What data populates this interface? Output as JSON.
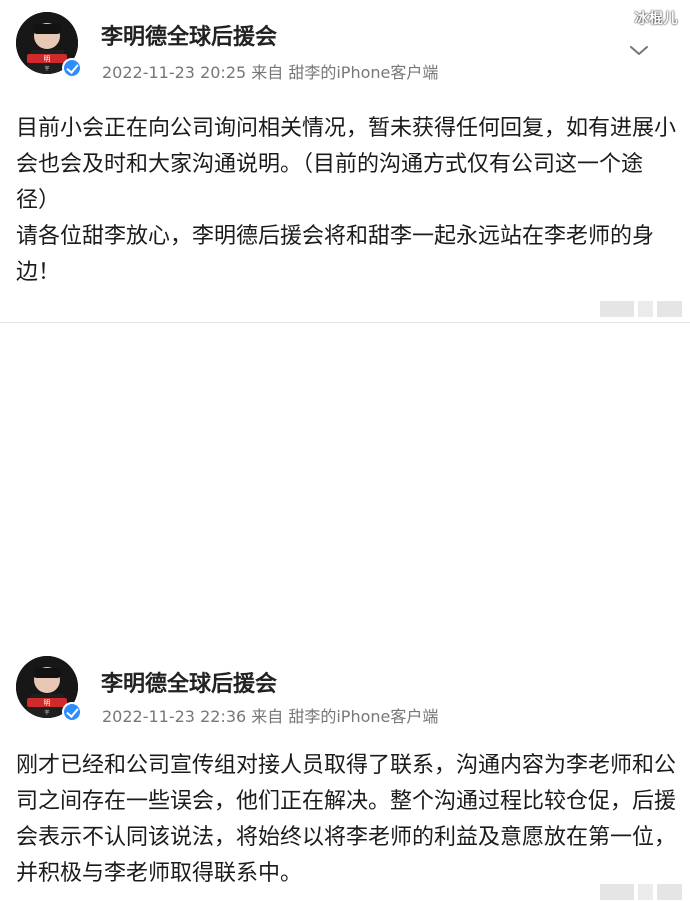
{
  "watermark": {
    "text": "冰棍儿"
  },
  "posts": [
    {
      "author": "李明德全球后援会",
      "meta": "2022-11-23 20:25  来自 甜李的iPhone客户端",
      "content": "目前小会正在向公司询问相关情况，暂未获得任何回复，如有进展小会也会及时和大家沟通说明。（目前的沟通方式仅有公司这一个途径）\n请各位甜李放心，李明德后援会将和甜李一起永远站在李老师的身边！",
      "avatar_text_top": "明",
      "avatar_text_bottom": "宇"
    },
    {
      "author": "李明德全球后援会",
      "meta": "2022-11-23 22:36  来自 甜李的iPhone客户端",
      "content": "刚才已经和公司宣传组对接人员取得了联系，沟通内容为李老师和公司之间存在一些误会，他们正在解决。整个沟通过程比较仓促，后援会表示不认同该说法，将始终以将李老师的利益及意愿放在第一位，并积极与李老师取得联系中。",
      "avatar_text_top": "明",
      "avatar_text_bottom": "宇"
    }
  ],
  "icons": {
    "chevron": "chevron-down-icon",
    "verified": "verified-badge-icon",
    "avatar": "avatar-image",
    "corner": "placeholder-icon"
  }
}
